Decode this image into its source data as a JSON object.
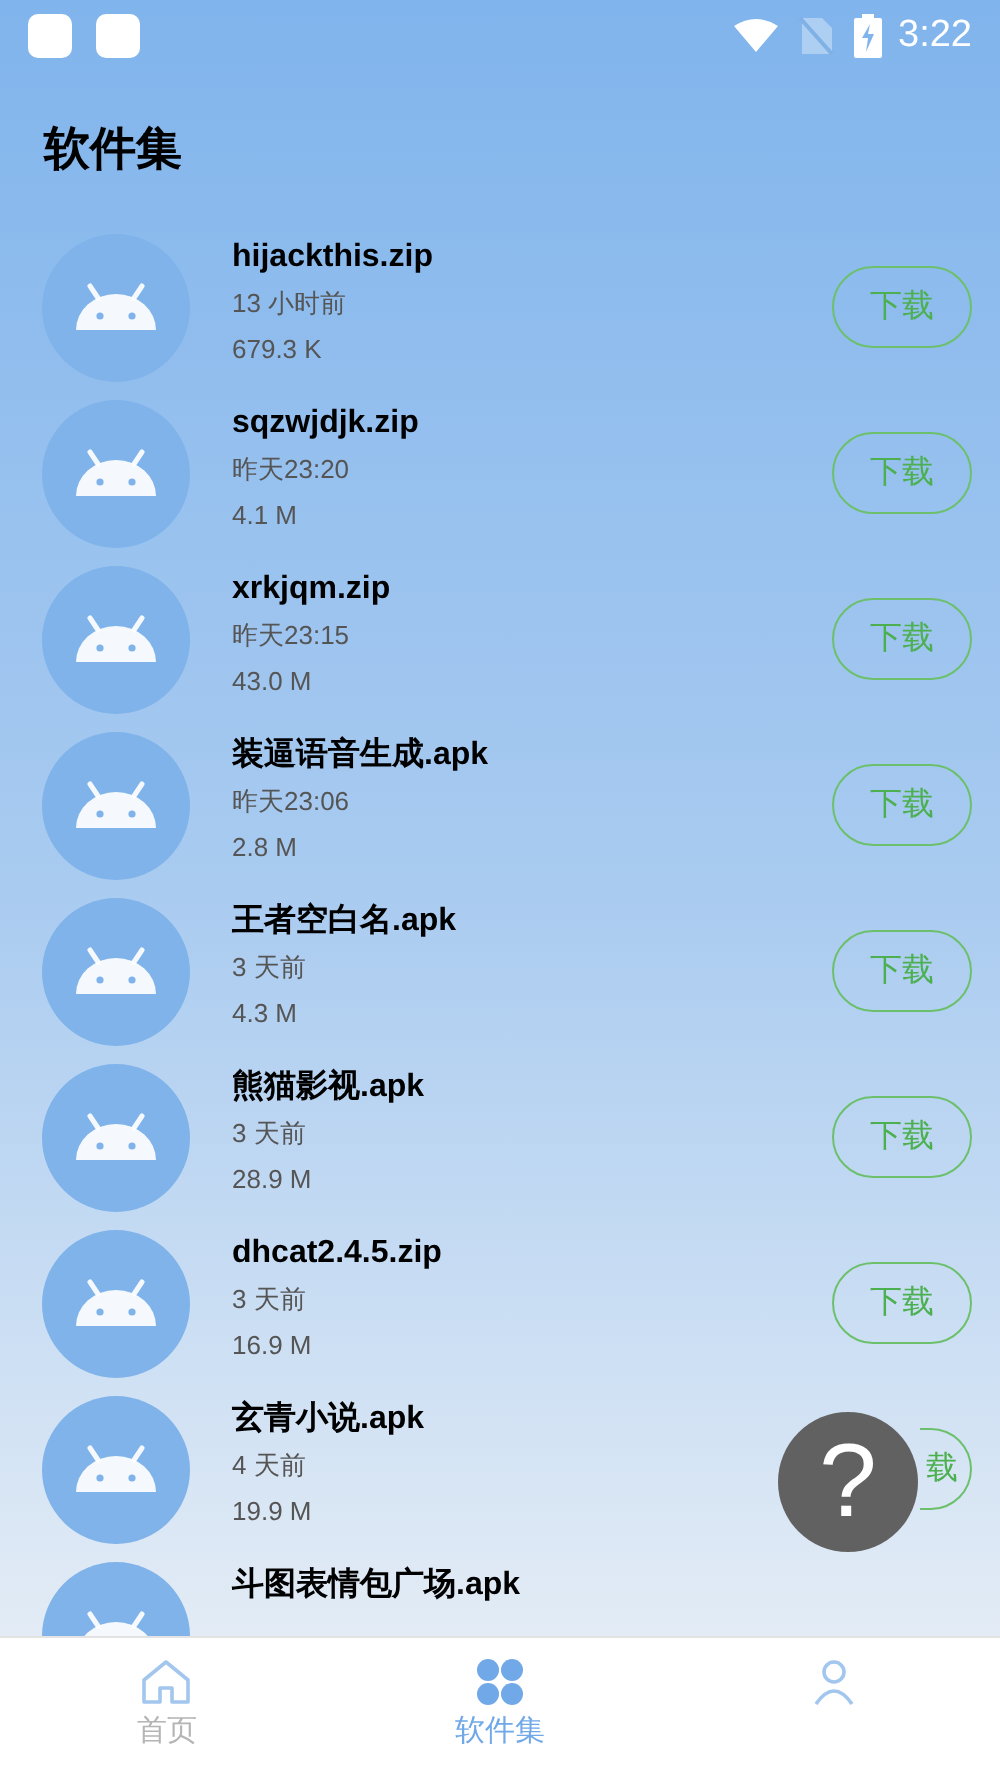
{
  "status_bar": {
    "time": "3:22"
  },
  "title": "软件集",
  "files": [
    {
      "name": "hijackthis.zip",
      "time": "13 小时前",
      "size": "679.3 K",
      "action": "下载"
    },
    {
      "name": "sqzwjdjk.zip",
      "time": "昨天23:20",
      "size": "4.1 M",
      "action": "下载"
    },
    {
      "name": "xrkjqm.zip",
      "time": "昨天23:15",
      "size": "43.0 M",
      "action": "下载"
    },
    {
      "name": "装逼语音生成.apk",
      "time": "昨天23:06",
      "size": "2.8 M",
      "action": "下载"
    },
    {
      "name": "王者空白名.apk",
      "time": "3 天前",
      "size": "4.3 M",
      "action": "下载"
    },
    {
      "name": "熊猫影视.apk",
      "time": "3 天前",
      "size": "28.9 M",
      "action": "下载"
    },
    {
      "name": "dhcat2.4.5.zip",
      "time": "3 天前",
      "size": "16.9 M",
      "action": "下载"
    },
    {
      "name": "玄青小说.apk",
      "time": "4 天前",
      "size": "19.9 M",
      "action": "载",
      "partly_hidden": true
    },
    {
      "name": "斗图表情包广场.apk"
    }
  ],
  "help_button": {
    "label": "?"
  },
  "tabs": [
    {
      "kind": "home",
      "label": "首页",
      "selected": false
    },
    {
      "kind": "apps",
      "label": "软件集",
      "selected": true
    },
    {
      "kind": "profile",
      "selected": false
    }
  ]
}
